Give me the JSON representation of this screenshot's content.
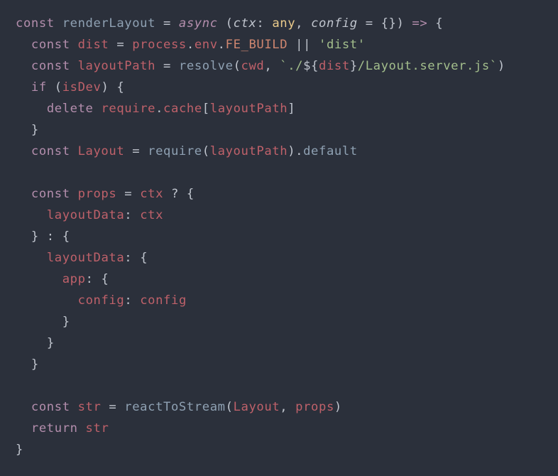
{
  "language": "javascript",
  "theme": {
    "background": "#2b303b",
    "default": "#c0c5ce",
    "keyword": "#b48ead",
    "function": "#8fa1b3",
    "identifier": "#bf616a",
    "type": "#ebcb8b",
    "string": "#a3be8c",
    "constant": "#d08770",
    "indentGuide": "#4f5b66"
  },
  "code": {
    "lines": [
      {
        "indent": 0,
        "tokens": [
          {
            "cls": "kw",
            "t": "const "
          },
          {
            "cls": "fn",
            "t": "renderLayout"
          },
          {
            "cls": "op",
            "t": " = "
          },
          {
            "cls": "kw2",
            "t": "async"
          },
          {
            "cls": "op",
            "t": " ("
          },
          {
            "cls": "paramI",
            "t": "ctx"
          },
          {
            "cls": "op",
            "t": ": "
          },
          {
            "cls": "type",
            "t": "any"
          },
          {
            "cls": "op",
            "t": ", "
          },
          {
            "cls": "paramI",
            "t": "config"
          },
          {
            "cls": "op",
            "t": " = {}) "
          },
          {
            "cls": "kw",
            "t": "=>"
          },
          {
            "cls": "op",
            "t": " {"
          }
        ]
      },
      {
        "indent": 1,
        "tokens": [
          {
            "cls": "kw",
            "t": "const "
          },
          {
            "cls": "id",
            "t": "dist"
          },
          {
            "cls": "op",
            "t": " = "
          },
          {
            "cls": "id",
            "t": "process"
          },
          {
            "cls": "op",
            "t": "."
          },
          {
            "cls": "id",
            "t": "env"
          },
          {
            "cls": "op",
            "t": "."
          },
          {
            "cls": "const",
            "t": "FE_BUILD"
          },
          {
            "cls": "op",
            "t": " || "
          },
          {
            "cls": "str",
            "t": "'dist'"
          }
        ]
      },
      {
        "indent": 1,
        "tokens": [
          {
            "cls": "kw",
            "t": "const "
          },
          {
            "cls": "id",
            "t": "layoutPath"
          },
          {
            "cls": "op",
            "t": " = "
          },
          {
            "cls": "fn",
            "t": "resolve"
          },
          {
            "cls": "op",
            "t": "("
          },
          {
            "cls": "id",
            "t": "cwd"
          },
          {
            "cls": "op",
            "t": ", "
          },
          {
            "cls": "str",
            "t": "`./"
          },
          {
            "cls": "tplEsc",
            "t": "${"
          },
          {
            "cls": "tplVar",
            "t": "dist"
          },
          {
            "cls": "tplEsc",
            "t": "}"
          },
          {
            "cls": "str",
            "t": "/Layout.server.js`"
          },
          {
            "cls": "op",
            "t": ")"
          }
        ]
      },
      {
        "indent": 1,
        "tokens": [
          {
            "cls": "kw",
            "t": "if"
          },
          {
            "cls": "op",
            "t": " ("
          },
          {
            "cls": "id",
            "t": "isDev"
          },
          {
            "cls": "op",
            "t": ") {"
          }
        ]
      },
      {
        "indent": 2,
        "tokens": [
          {
            "cls": "kw",
            "t": "delete "
          },
          {
            "cls": "id",
            "t": "require"
          },
          {
            "cls": "op",
            "t": "."
          },
          {
            "cls": "id",
            "t": "cache"
          },
          {
            "cls": "op",
            "t": "["
          },
          {
            "cls": "id",
            "t": "layoutPath"
          },
          {
            "cls": "op",
            "t": "]"
          }
        ]
      },
      {
        "indent": 1,
        "tokens": [
          {
            "cls": "op",
            "t": "}"
          }
        ]
      },
      {
        "indent": 1,
        "tokens": [
          {
            "cls": "kw",
            "t": "const "
          },
          {
            "cls": "id",
            "t": "Layout"
          },
          {
            "cls": "op",
            "t": " = "
          },
          {
            "cls": "fn",
            "t": "require"
          },
          {
            "cls": "op",
            "t": "("
          },
          {
            "cls": "id",
            "t": "layoutPath"
          },
          {
            "cls": "op",
            "t": ")."
          },
          {
            "cls": "fn",
            "t": "default"
          }
        ]
      },
      {
        "indent": 0,
        "tokens": [
          {
            "cls": "op",
            "t": ""
          }
        ]
      },
      {
        "indent": 1,
        "tokens": [
          {
            "cls": "kw",
            "t": "const "
          },
          {
            "cls": "id",
            "t": "props"
          },
          {
            "cls": "op",
            "t": " = "
          },
          {
            "cls": "id",
            "t": "ctx"
          },
          {
            "cls": "op",
            "t": " ? {"
          }
        ]
      },
      {
        "indent": 2,
        "tokens": [
          {
            "cls": "id",
            "t": "layoutData"
          },
          {
            "cls": "op",
            "t": ": "
          },
          {
            "cls": "id",
            "t": "ctx"
          }
        ]
      },
      {
        "indent": 1,
        "tokens": [
          {
            "cls": "op",
            "t": "} : {"
          }
        ]
      },
      {
        "indent": 2,
        "tokens": [
          {
            "cls": "id",
            "t": "layoutData"
          },
          {
            "cls": "op",
            "t": ": {"
          }
        ]
      },
      {
        "indent": 3,
        "tokens": [
          {
            "cls": "id",
            "t": "app"
          },
          {
            "cls": "op",
            "t": ": {"
          }
        ]
      },
      {
        "indent": 4,
        "tokens": [
          {
            "cls": "id",
            "t": "config"
          },
          {
            "cls": "op",
            "t": ": "
          },
          {
            "cls": "id",
            "t": "config"
          }
        ]
      },
      {
        "indent": 3,
        "tokens": [
          {
            "cls": "op",
            "t": "}"
          }
        ]
      },
      {
        "indent": 2,
        "tokens": [
          {
            "cls": "op",
            "t": "}"
          }
        ]
      },
      {
        "indent": 1,
        "tokens": [
          {
            "cls": "op",
            "t": "}"
          }
        ]
      },
      {
        "indent": 0,
        "tokens": [
          {
            "cls": "op",
            "t": ""
          }
        ]
      },
      {
        "indent": 1,
        "tokens": [
          {
            "cls": "kw",
            "t": "const "
          },
          {
            "cls": "id",
            "t": "str"
          },
          {
            "cls": "op",
            "t": " = "
          },
          {
            "cls": "fn",
            "t": "reactToStream"
          },
          {
            "cls": "op",
            "t": "("
          },
          {
            "cls": "id",
            "t": "Layout"
          },
          {
            "cls": "op",
            "t": ", "
          },
          {
            "cls": "id",
            "t": "props"
          },
          {
            "cls": "op",
            "t": ")"
          }
        ]
      },
      {
        "indent": 1,
        "tokens": [
          {
            "cls": "kw",
            "t": "return "
          },
          {
            "cls": "id",
            "t": "str"
          }
        ]
      },
      {
        "indent": 0,
        "tokens": [
          {
            "cls": "op",
            "t": "}"
          }
        ]
      }
    ]
  }
}
